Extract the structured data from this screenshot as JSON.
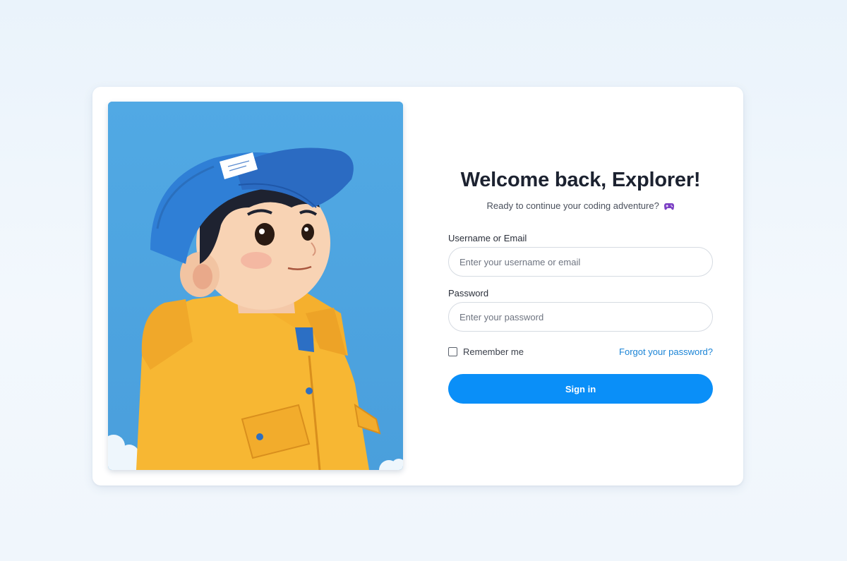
{
  "login": {
    "title": "Welcome back, Explorer!",
    "subtitle": "Ready to continue your coding adventure?",
    "subtitle_icon": "gamepad-icon",
    "username_label": "Username or Email",
    "username_placeholder": "Enter your username or email",
    "username_value": "",
    "password_label": "Password",
    "password_placeholder": "Enter your password",
    "password_value": "",
    "remember_label": "Remember me",
    "remember_checked": false,
    "forgot_label": "Forgot your password?",
    "signin_label": "Sign in"
  },
  "colors": {
    "accent": "#0a8ff8",
    "link": "#1b84d6",
    "hero_sky": "#4fa6e0",
    "jacket": "#f7b733",
    "cap": "#2f7fd6"
  }
}
